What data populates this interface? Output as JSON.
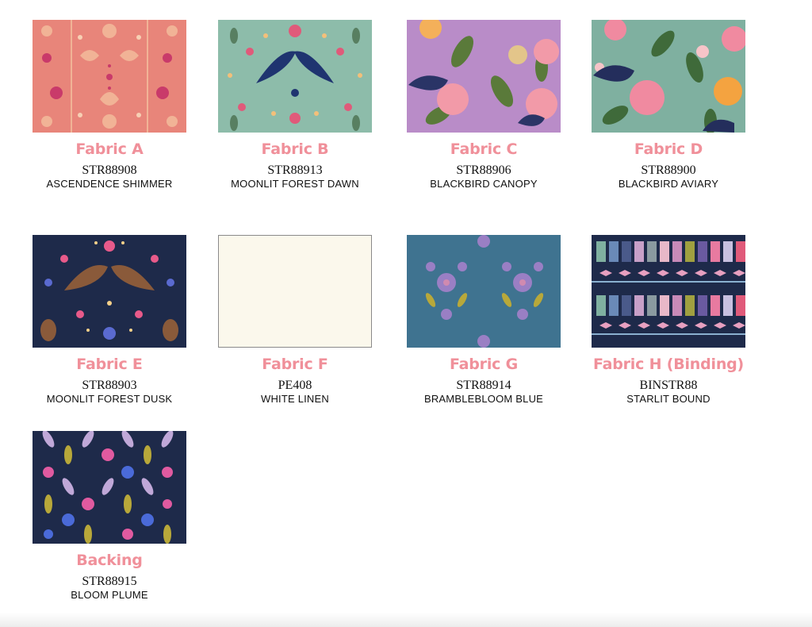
{
  "fabrics": [
    {
      "label": "Fabric A",
      "code": "STR88908",
      "name": "ASCENDENCE SHIMMER",
      "swatch": "coral-celestial-pattern"
    },
    {
      "label": "Fabric B",
      "code": "STR88913",
      "name": "MOONLIT FOREST DAWN",
      "swatch": "sage-swallow-pattern"
    },
    {
      "label": "Fabric C",
      "code": "STR88906",
      "name": "BLACKBIRD CANOPY",
      "swatch": "lilac-blackbird-floral"
    },
    {
      "label": "Fabric D",
      "code": "STR88900",
      "name": "BLACKBIRD AVIARY",
      "swatch": "sage-blackbird-floral"
    },
    {
      "label": "Fabric E",
      "code": "STR88903",
      "name": "MOONLIT FOREST DUSK",
      "swatch": "navy-hare-pattern"
    },
    {
      "label": "Fabric F",
      "code": "PE408",
      "name": "WHITE LINEN",
      "swatch": "plain-cream"
    },
    {
      "label": "Fabric G",
      "code": "STR88914",
      "name": "BRAMBLEBLOOM BLUE",
      "swatch": "teal-bloom-pattern"
    },
    {
      "label": "Fabric H (Binding)",
      "code": "BINSTR88",
      "name": "STARLIT BOUND",
      "swatch": "striped-binding"
    },
    {
      "label": "Backing",
      "code": "STR88915",
      "name": "BLOOM PLUME",
      "swatch": "navy-bloom-plume"
    }
  ],
  "colors": {
    "label": "#f0909a",
    "coral": "#e8857a",
    "sage": "#8dbcaa",
    "lilac": "#b98cc8",
    "navy": "#1e2a4a",
    "cream": "#fbf8ec",
    "teal": "#3f7390"
  }
}
